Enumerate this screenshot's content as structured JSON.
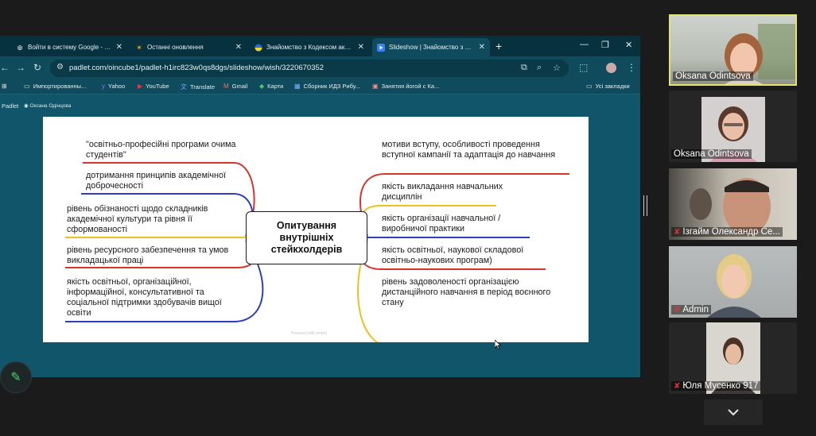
{
  "browser": {
    "tabs": [
      {
        "icon": "zoom-icon",
        "title": "Войти в систему Google - Zoom",
        "active": false
      },
      {
        "icon": "spark-icon",
        "title": "Останні оновлення",
        "active": false
      },
      {
        "icon": "ukraine-flag-icon",
        "title": "Знайомство з Кодексом академ",
        "active": false
      },
      {
        "icon": "slideshow-icon",
        "title": "Slideshow | Знайомство з Кодекс",
        "active": true
      }
    ],
    "url": "padlet.com/oincube1/padlet-h1irc823w0qs8dgs/slideshow/wish/3220670352",
    "bookmarks": [
      {
        "icon": "folder-icon",
        "label": "Импортированны..."
      },
      {
        "icon": "yahoo-icon",
        "label": "Yahoo"
      },
      {
        "icon": "youtube-icon",
        "label": "YouTube"
      },
      {
        "icon": "translate-icon",
        "label": "Translate"
      },
      {
        "icon": "gmail-icon",
        "label": "Gmail"
      },
      {
        "icon": "maps-icon",
        "label": "Карти"
      },
      {
        "icon": "grid-icon",
        "label": "Сборник ИДЗ Рибу..."
      },
      {
        "icon": "yoga-icon",
        "label": "Занятия йогой с Ка..."
      }
    ],
    "all_bookmarks": "Усі закладки"
  },
  "padlet": {
    "logo": "Padlet",
    "author": "Оксана Одінцова"
  },
  "mindmap": {
    "center": "Опитування внутрішніх стейкхолдерів",
    "left": [
      {
        "text": "\"освітньо-професійні програми очима студентів\"",
        "color": "#d9342b"
      },
      {
        "text": "дотримання принципів академічної доброчесності",
        "color": "#2b3fbf"
      },
      {
        "text": "рівень обізнаності щодо складників академічної культури та рівня її сформованості",
        "color": "#e8c320"
      },
      {
        "text": "рівень ресурсного забезпечення та умов викладацької праці",
        "color": "#d9342b"
      },
      {
        "text": "якість освітньої, організаційної, інформаційної, консультативної та соціальної підтримки здобувачів вищої освіти",
        "color": "#2b3fbf"
      }
    ],
    "right": [
      {
        "text": "мотиви вступу, особливості проведення вступної кампанії та адаптація до навчання",
        "color": "#d9342b"
      },
      {
        "text": "якість викладання навчальних дисциплін",
        "color": "#e8c320"
      },
      {
        "text": "якість організації навчальної / виробничої практики",
        "color": "#2b3fbf"
      },
      {
        "text": "якість освітньої, наукової складової освітньо-наукових програм)",
        "color": "#d9342b"
      },
      {
        "text": "рівень задоволеності організацією дистанційного навчання в період воєнного стану",
        "color": "#e8c320"
      }
    ],
    "watermark": "Powered with xmind"
  },
  "participants": [
    {
      "name": "Oksana Odintsova",
      "muted": false,
      "active": true
    },
    {
      "name": "Oksana Odintsova",
      "muted": false,
      "active": false
    },
    {
      "name": "Ізгайм Олександр Се...",
      "muted": true,
      "active": false
    },
    {
      "name": "Admin",
      "muted": true,
      "active": false
    },
    {
      "name": "Юля Мусенко 917",
      "muted": true,
      "active": false
    }
  ]
}
